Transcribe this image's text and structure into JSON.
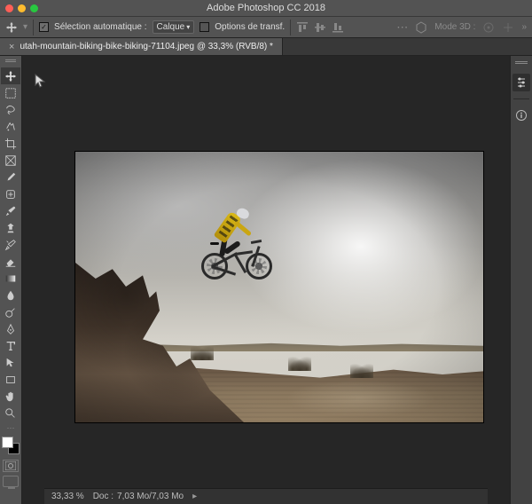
{
  "window": {
    "title": "Adobe Photoshop CC 2018",
    "traffic_colors": {
      "close": "#ff5f57",
      "min": "#febc2e",
      "max": "#28c840"
    }
  },
  "options_bar": {
    "auto_select_label": "Sélection automatique :",
    "layer_dropdown": "Calque",
    "transform_label": "Options de transf.",
    "mode3d_label": "Mode 3D :"
  },
  "tab": {
    "title": "utah-mountain-biking-bike-biking-71104.jpeg @ 33,3% (RVB/8) *"
  },
  "tools": [
    "move-tool",
    "marquee-tool",
    "lasso-tool",
    "quick-select-tool",
    "crop-tool",
    "frame-tool",
    "eyedropper-tool",
    "healing-brush-tool",
    "brush-tool",
    "clone-stamp-tool",
    "history-brush-tool",
    "eraser-tool",
    "gradient-tool",
    "blur-tool",
    "dodge-tool",
    "pen-tool",
    "type-tool",
    "path-select-tool",
    "rectangle-tool",
    "hand-tool",
    "zoom-tool"
  ],
  "right_panel_icons": [
    "adjustments-icon",
    "info-icon"
  ],
  "status": {
    "zoom": "33,33 %",
    "doc_label": "Doc :",
    "doc_value": "7,03 Mo/7,03 Mo"
  }
}
